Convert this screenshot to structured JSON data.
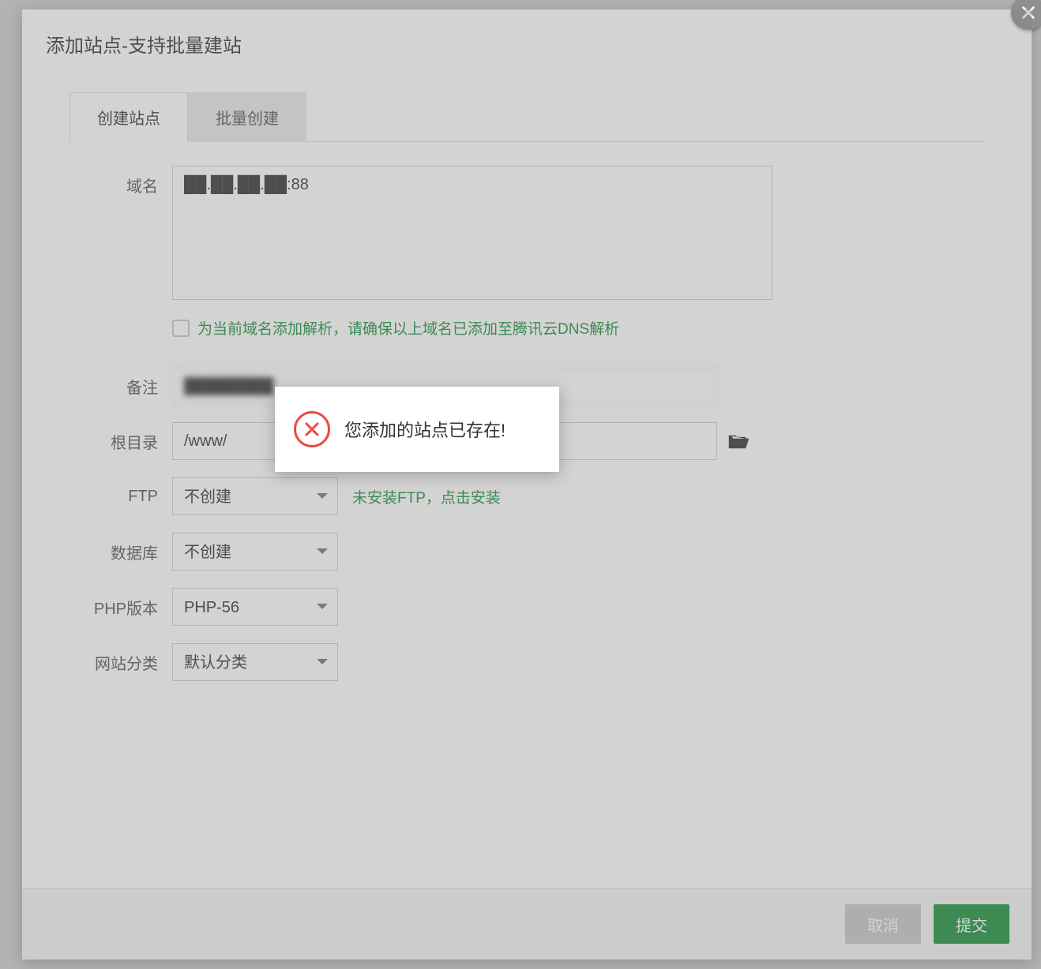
{
  "modal": {
    "title": "添加站点-支持批量建站",
    "tabs": [
      {
        "label": "创建站点",
        "active": true
      },
      {
        "label": "批量创建",
        "active": false
      }
    ]
  },
  "form": {
    "domain": {
      "label": "域名",
      "value": "██.██.██.██:88"
    },
    "dns_checkbox": {
      "checked": false,
      "label": "为当前域名添加解析，请确保以上域名已添加至腾讯云DNS解析"
    },
    "note": {
      "label": "备注",
      "value": "████████"
    },
    "root": {
      "label": "根目录",
      "value": "/www/"
    },
    "ftp": {
      "label": "FTP",
      "value": "不创建",
      "hint": "未安装FTP，点击安装"
    },
    "database": {
      "label": "数据库",
      "value": "不创建"
    },
    "php": {
      "label": "PHP版本",
      "value": "PHP-56"
    },
    "category": {
      "label": "网站分类",
      "value": "默认分类"
    }
  },
  "footer": {
    "cancel": "取消",
    "submit": "提交"
  },
  "toast": {
    "message": "您添加的站点已存在!"
  },
  "colors": {
    "accent": "#1a8f3b",
    "error": "#e84c3d"
  }
}
